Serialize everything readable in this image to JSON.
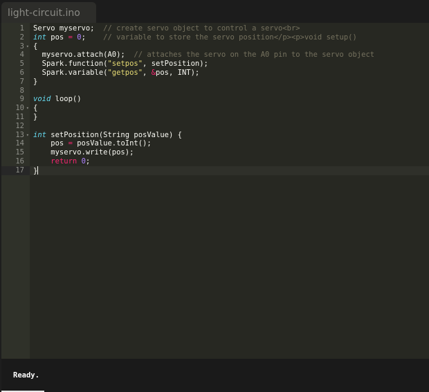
{
  "tab": {
    "filename": "light-circuit.ino"
  },
  "editor": {
    "lines": [
      {
        "num": "1",
        "fold": "",
        "tokens": [
          [
            "",
            "Servo myservo;  "
          ],
          [
            "cm",
            "// create servo object to control a servo<br>"
          ]
        ]
      },
      {
        "num": "2",
        "fold": "",
        "tokens": [
          [
            "kw",
            "int"
          ],
          [
            "",
            " pos "
          ],
          [
            "op",
            "="
          ],
          [
            "",
            " "
          ],
          [
            "num-lit",
            "0"
          ],
          [
            "",
            ";    "
          ],
          [
            "cm",
            "// variable to store the servo position</p><p>void setup()"
          ]
        ]
      },
      {
        "num": "3",
        "fold": "▾",
        "tokens": [
          [
            "",
            "{"
          ]
        ]
      },
      {
        "num": "4",
        "fold": "",
        "tokens": [
          [
            "",
            "  myservo.attach(A0);  "
          ],
          [
            "cm",
            "// attaches the servo on the A0 pin to the servo object"
          ]
        ]
      },
      {
        "num": "5",
        "fold": "",
        "tokens": [
          [
            "",
            "  Spark.function("
          ],
          [
            "str",
            "\"setpos\""
          ],
          [
            "",
            ", setPosition);"
          ]
        ]
      },
      {
        "num": "6",
        "fold": "",
        "tokens": [
          [
            "",
            "  Spark.variable("
          ],
          [
            "str",
            "\"getpos\""
          ],
          [
            "",
            ", "
          ],
          [
            "op",
            "&"
          ],
          [
            "",
            "pos, INT);"
          ]
        ]
      },
      {
        "num": "7",
        "fold": "",
        "tokens": [
          [
            "",
            "}"
          ]
        ]
      },
      {
        "num": "8",
        "fold": "",
        "tokens": []
      },
      {
        "num": "9",
        "fold": "",
        "tokens": [
          [
            "kw",
            "void"
          ],
          [
            "",
            " loop()"
          ]
        ]
      },
      {
        "num": "10",
        "fold": "▾",
        "tokens": [
          [
            "",
            "{"
          ]
        ]
      },
      {
        "num": "11",
        "fold": "",
        "tokens": [
          [
            "",
            "}"
          ]
        ]
      },
      {
        "num": "12",
        "fold": "",
        "tokens": []
      },
      {
        "num": "13",
        "fold": "▾",
        "tokens": [
          [
            "kw",
            "int"
          ],
          [
            "",
            " setPosition(String posValue) {"
          ]
        ]
      },
      {
        "num": "14",
        "fold": "",
        "tokens": [
          [
            "",
            "    pos "
          ],
          [
            "op",
            "="
          ],
          [
            "",
            " posValue.toInt();"
          ]
        ]
      },
      {
        "num": "15",
        "fold": "",
        "tokens": [
          [
            "",
            "    myservo.write(pos);"
          ]
        ]
      },
      {
        "num": "16",
        "fold": "",
        "tokens": [
          [
            "",
            "    "
          ],
          [
            "op",
            "return"
          ],
          [
            "",
            " "
          ],
          [
            "num-lit",
            "0"
          ],
          [
            "",
            ";"
          ]
        ]
      },
      {
        "num": "17",
        "fold": "",
        "tokens": [
          [
            "",
            "}"
          ]
        ],
        "active": true
      }
    ]
  },
  "status": {
    "text": "Ready."
  },
  "colors": {
    "editor_bg": "#272822",
    "gutter_bg": "#2f3129",
    "keyword": "#66d9ef",
    "string": "#e6db74",
    "number": "#ae81ff",
    "operator": "#f92672",
    "comment": "#75715e",
    "text": "#f8f8f2"
  }
}
